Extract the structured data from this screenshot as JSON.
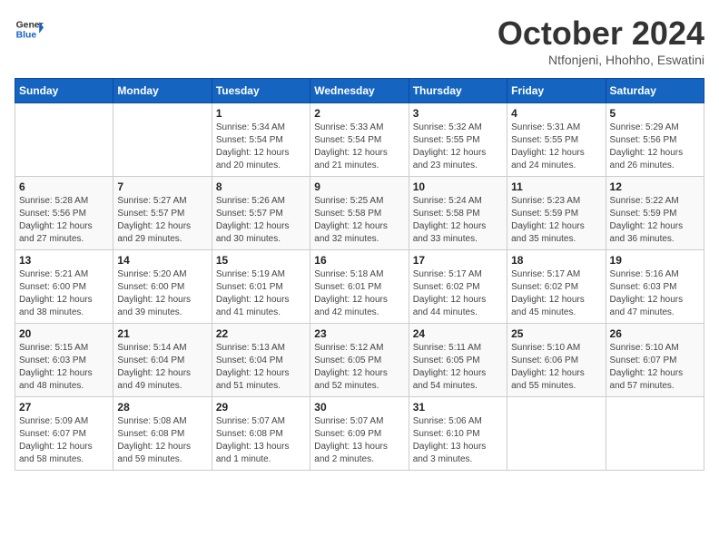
{
  "header": {
    "logo_general": "General",
    "logo_blue": "Blue",
    "month_title": "October 2024",
    "location": "Ntfonjeni, Hhohho, Eswatini"
  },
  "weekdays": [
    "Sunday",
    "Monday",
    "Tuesday",
    "Wednesday",
    "Thursday",
    "Friday",
    "Saturday"
  ],
  "weeks": [
    [
      {
        "day": "",
        "info": ""
      },
      {
        "day": "",
        "info": ""
      },
      {
        "day": "1",
        "info": "Sunrise: 5:34 AM\nSunset: 5:54 PM\nDaylight: 12 hours and 20 minutes."
      },
      {
        "day": "2",
        "info": "Sunrise: 5:33 AM\nSunset: 5:54 PM\nDaylight: 12 hours and 21 minutes."
      },
      {
        "day": "3",
        "info": "Sunrise: 5:32 AM\nSunset: 5:55 PM\nDaylight: 12 hours and 23 minutes."
      },
      {
        "day": "4",
        "info": "Sunrise: 5:31 AM\nSunset: 5:55 PM\nDaylight: 12 hours and 24 minutes."
      },
      {
        "day": "5",
        "info": "Sunrise: 5:29 AM\nSunset: 5:56 PM\nDaylight: 12 hours and 26 minutes."
      }
    ],
    [
      {
        "day": "6",
        "info": "Sunrise: 5:28 AM\nSunset: 5:56 PM\nDaylight: 12 hours and 27 minutes."
      },
      {
        "day": "7",
        "info": "Sunrise: 5:27 AM\nSunset: 5:57 PM\nDaylight: 12 hours and 29 minutes."
      },
      {
        "day": "8",
        "info": "Sunrise: 5:26 AM\nSunset: 5:57 PM\nDaylight: 12 hours and 30 minutes."
      },
      {
        "day": "9",
        "info": "Sunrise: 5:25 AM\nSunset: 5:58 PM\nDaylight: 12 hours and 32 minutes."
      },
      {
        "day": "10",
        "info": "Sunrise: 5:24 AM\nSunset: 5:58 PM\nDaylight: 12 hours and 33 minutes."
      },
      {
        "day": "11",
        "info": "Sunrise: 5:23 AM\nSunset: 5:59 PM\nDaylight: 12 hours and 35 minutes."
      },
      {
        "day": "12",
        "info": "Sunrise: 5:22 AM\nSunset: 5:59 PM\nDaylight: 12 hours and 36 minutes."
      }
    ],
    [
      {
        "day": "13",
        "info": "Sunrise: 5:21 AM\nSunset: 6:00 PM\nDaylight: 12 hours and 38 minutes."
      },
      {
        "day": "14",
        "info": "Sunrise: 5:20 AM\nSunset: 6:00 PM\nDaylight: 12 hours and 39 minutes."
      },
      {
        "day": "15",
        "info": "Sunrise: 5:19 AM\nSunset: 6:01 PM\nDaylight: 12 hours and 41 minutes."
      },
      {
        "day": "16",
        "info": "Sunrise: 5:18 AM\nSunset: 6:01 PM\nDaylight: 12 hours and 42 minutes."
      },
      {
        "day": "17",
        "info": "Sunrise: 5:17 AM\nSunset: 6:02 PM\nDaylight: 12 hours and 44 minutes."
      },
      {
        "day": "18",
        "info": "Sunrise: 5:17 AM\nSunset: 6:02 PM\nDaylight: 12 hours and 45 minutes."
      },
      {
        "day": "19",
        "info": "Sunrise: 5:16 AM\nSunset: 6:03 PM\nDaylight: 12 hours and 47 minutes."
      }
    ],
    [
      {
        "day": "20",
        "info": "Sunrise: 5:15 AM\nSunset: 6:03 PM\nDaylight: 12 hours and 48 minutes."
      },
      {
        "day": "21",
        "info": "Sunrise: 5:14 AM\nSunset: 6:04 PM\nDaylight: 12 hours and 49 minutes."
      },
      {
        "day": "22",
        "info": "Sunrise: 5:13 AM\nSunset: 6:04 PM\nDaylight: 12 hours and 51 minutes."
      },
      {
        "day": "23",
        "info": "Sunrise: 5:12 AM\nSunset: 6:05 PM\nDaylight: 12 hours and 52 minutes."
      },
      {
        "day": "24",
        "info": "Sunrise: 5:11 AM\nSunset: 6:05 PM\nDaylight: 12 hours and 54 minutes."
      },
      {
        "day": "25",
        "info": "Sunrise: 5:10 AM\nSunset: 6:06 PM\nDaylight: 12 hours and 55 minutes."
      },
      {
        "day": "26",
        "info": "Sunrise: 5:10 AM\nSunset: 6:07 PM\nDaylight: 12 hours and 57 minutes."
      }
    ],
    [
      {
        "day": "27",
        "info": "Sunrise: 5:09 AM\nSunset: 6:07 PM\nDaylight: 12 hours and 58 minutes."
      },
      {
        "day": "28",
        "info": "Sunrise: 5:08 AM\nSunset: 6:08 PM\nDaylight: 12 hours and 59 minutes."
      },
      {
        "day": "29",
        "info": "Sunrise: 5:07 AM\nSunset: 6:08 PM\nDaylight: 13 hours and 1 minute."
      },
      {
        "day": "30",
        "info": "Sunrise: 5:07 AM\nSunset: 6:09 PM\nDaylight: 13 hours and 2 minutes."
      },
      {
        "day": "31",
        "info": "Sunrise: 5:06 AM\nSunset: 6:10 PM\nDaylight: 13 hours and 3 minutes."
      },
      {
        "day": "",
        "info": ""
      },
      {
        "day": "",
        "info": ""
      }
    ]
  ]
}
